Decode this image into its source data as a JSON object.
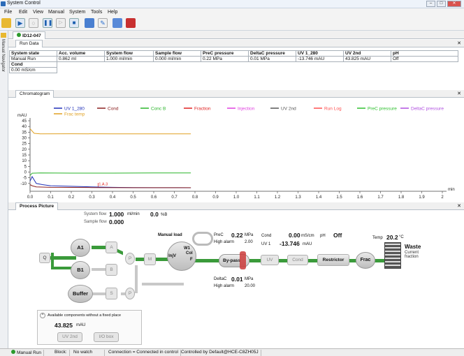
{
  "window": {
    "title": "System Control"
  },
  "menu": [
    "File",
    "Edit",
    "View",
    "Manual",
    "System",
    "Tools",
    "Help"
  ],
  "nav": {
    "label": "Manual Navigator"
  },
  "doc_tab": "ID12-047",
  "run_data": {
    "tab": "Run Data",
    "headers": [
      "System state",
      "Acc. volume",
      "System flow",
      "Sample flow",
      "PreC pressure",
      "DeltaC pressure",
      "UV 1_280",
      "UV 2nd",
      "pH"
    ],
    "values": [
      "Manual Run",
      "0.862 ml",
      "1.000 ml/min",
      "0.000 ml/min",
      "0.22 MPa",
      "0.01 MPa",
      "-13.746 mAU",
      "43.825 mAU",
      "Off"
    ],
    "cond_header": "Cond",
    "cond_value": "0.00 mS/cm"
  },
  "chromatogram": {
    "tab": "Chromatogram",
    "legend": [
      {
        "label": "UV 1_280",
        "color": "#1f2fb8"
      },
      {
        "label": "Cond",
        "color": "#8b2020"
      },
      {
        "label": "Conc B",
        "color": "#2bb52b"
      },
      {
        "label": "Fraction",
        "color": "#e02020"
      },
      {
        "label": "Injection",
        "color": "#e040e0"
      },
      {
        "label": "UV 2nd",
        "color": "#555555"
      },
      {
        "label": "Run Log",
        "color": "#ff5050"
      },
      {
        "label": "PreC pressure",
        "color": "#30c030"
      },
      {
        "label": "DeltaC pressure",
        "color": "#b050e0"
      },
      {
        "label": "Frac temp",
        "color": "#e0a020"
      }
    ]
  },
  "chart_data": {
    "type": "line",
    "ylabel": "mAU",
    "xlabel": "min",
    "ylim": [
      -15,
      45
    ],
    "xlim": [
      0,
      2
    ],
    "y_ticks": [
      "45",
      "40",
      "35",
      "30",
      "25",
      "20",
      "15",
      "10",
      "5",
      "0",
      "-5",
      "-10"
    ],
    "x_ticks": [
      "0.0",
      "0.1",
      "0.2",
      "0.3",
      "0.4",
      "0.5",
      "0.6",
      "0.7",
      "0.8",
      "0.9",
      "1.0",
      "1.1",
      "1.2",
      "1.3",
      "1.4",
      "1.5",
      "1.6",
      "1.7",
      "1.8",
      "1.9",
      "2"
    ],
    "annotation": "1.A.3",
    "series": [
      {
        "name": "UV 1_280",
        "color": "#1f2fb8",
        "x": [
          0,
          0.01,
          0.03,
          0.06,
          0.1,
          0.2,
          0.3,
          0.4,
          0.5,
          0.6,
          0.7,
          0.78
        ],
        "y": [
          -8,
          -4,
          -10,
          -11,
          -12,
          -12.5,
          -13,
          -13.4,
          -13.6,
          -13.7,
          -13.7,
          -13.746
        ]
      },
      {
        "name": "Conc B",
        "color": "#2bb52b",
        "x": [
          0,
          0.01,
          0.05,
          0.2,
          0.4,
          0.6,
          0.78
        ],
        "y": [
          -3,
          -1,
          -0.8,
          -0.9,
          -0.9,
          -0.8,
          -0.8
        ]
      },
      {
        "name": "Frac temp",
        "color": "#e0a020",
        "x": [
          0,
          0.02,
          0.05,
          0.2,
          0.4,
          0.6,
          0.78
        ],
        "y": [
          38,
          34,
          33.5,
          33.6,
          33.5,
          33.5,
          33.5
        ]
      },
      {
        "name": "Cond",
        "color": "#8b2020",
        "x": [
          0,
          0.01,
          0.03,
          0.1,
          0.3,
          0.5,
          0.78
        ],
        "y": [
          -11,
          -12,
          -13,
          -13.4,
          -13.6,
          -13.7,
          -13.7
        ]
      }
    ]
  },
  "process": {
    "tab": "Process Picture",
    "system_flow_label": "System flow",
    "system_flow_value": "1.000",
    "system_flow_unit": "ml/min",
    "percent_value": "0.0",
    "percent_unit": "%B",
    "sample_flow_label": "Sample flow",
    "sample_flow_value": "0.000",
    "manual_load": "Manual load",
    "prec_label": "PreC",
    "prec_value": "0.22",
    "prec_unit": "MPa",
    "high_alarm_label": "High alarm",
    "high_alarm_prec": "2.00",
    "cond_label": "Cond",
    "cond_value": "0.00",
    "cond_unit": "mS/cm",
    "ph_label": "pH",
    "ph_value": "Off",
    "uv1_label": "UV 1",
    "uv1_value": "-13.746",
    "uv1_unit": "mAU",
    "deltac_label": "DeltaC",
    "deltac_value": "0.01",
    "deltac_unit": "MPa",
    "high_alarm_deltac": "20.00",
    "temp_label": "Temp",
    "temp_value": "20.2",
    "temp_unit": "°C",
    "waste_label": "Waste",
    "current_fraction": "Current\nfraction",
    "components": {
      "q": "Q",
      "a1": "A1",
      "b1": "B1",
      "buffer": "Buffer",
      "a": "A",
      "b": "B",
      "s": "S",
      "p1": "P",
      "p2": "P",
      "m": "M",
      "inj": "InjV",
      "w1": "W1",
      "col": "Col",
      "f": "F",
      "bypass": "By-pass",
      "uv": "UV",
      "cond": "Cond",
      "restrictor": "Restrictor",
      "frac": "Frac",
      "w": "W"
    },
    "avail_title": "Available components without a fixed place",
    "avail_value": "43.825",
    "avail_unit": "mAU",
    "uv2_button": "UV 2nd",
    "io_button": "I/O box"
  },
  "status": {
    "mode": "Manual Run",
    "block_label": "Block:",
    "watch": "No watch",
    "connection": "Connection = Connected in control",
    "controlled": "Controlled by Default@HCE-C8ZH05J"
  }
}
